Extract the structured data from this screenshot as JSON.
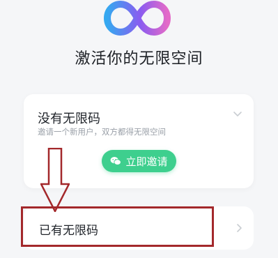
{
  "header": {
    "logo_icon": "infinity-logo-icon",
    "title": "激活你的无限空间"
  },
  "no_code_card": {
    "title": "没有无限码",
    "subtitle": "邀请一个新用户，双方都得无限空间",
    "expand_icon": "chevron-down-icon",
    "invite_button": {
      "icon": "wechat-icon",
      "label": "立即邀请"
    }
  },
  "has_code_row": {
    "label": "已有无限码",
    "icon": "chevron-right-icon"
  },
  "annotation": {
    "arrow_icon": "down-arrow-outline-icon",
    "color": "#a3282b"
  },
  "colors": {
    "background": "#f5f6f8",
    "button_green": "#3ecf8e",
    "logo_gradient": [
      "#35a8f0",
      "#8a5cf0",
      "#e36ac8"
    ]
  }
}
